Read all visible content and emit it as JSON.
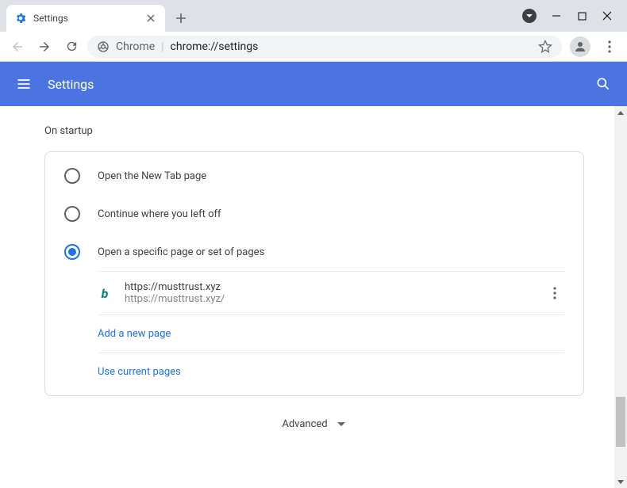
{
  "window": {
    "tab_title": "Settings",
    "omnibox_label": "Chrome",
    "omnibox_url": "chrome://settings"
  },
  "header": {
    "title": "Settings"
  },
  "section": {
    "title": "On startup"
  },
  "radios": [
    {
      "label": "Open the New Tab page",
      "selected": false
    },
    {
      "label": "Continue where you left off",
      "selected": false
    },
    {
      "label": "Open a specific page or set of pages",
      "selected": true
    }
  ],
  "pages": [
    {
      "title": "https://musttrust.xyz",
      "url": "https://musttrust.xyz/",
      "icon": "b"
    }
  ],
  "links": {
    "add_page": "Add a new page",
    "use_current": "Use current pages"
  },
  "advanced_label": "Advanced",
  "colors": {
    "accent": "#1a73e8",
    "header": "#4b74e0"
  }
}
